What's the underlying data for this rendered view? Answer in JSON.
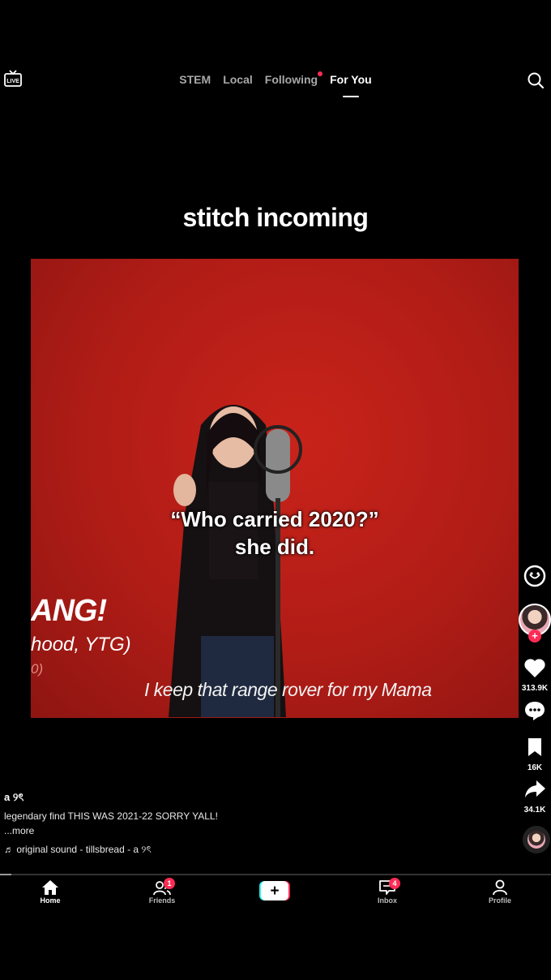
{
  "top_nav": {
    "live_label": "LIVE",
    "tabs": [
      {
        "label": "STEM",
        "active": false
      },
      {
        "label": "Local",
        "active": false
      },
      {
        "label": "Following",
        "active": false,
        "has_dot": true
      },
      {
        "label": "For You",
        "active": true
      }
    ]
  },
  "caption_top": "stitch incoming",
  "video": {
    "overlay_line1": "“Who carried 2020?”",
    "overlay_line2": "she did.",
    "side_title": "ANG!",
    "side_credit": "hood, YTG)",
    "side_year": "0)",
    "lyric": "I keep that range rover for my Mama"
  },
  "right_rail": {
    "like_count": "313.9K",
    "bookmark_count": "16K",
    "share_count": "34.1K",
    "follow_symbol": "+"
  },
  "post": {
    "username": "a ୨ৎ",
    "description": "legendary find THIS WAS 2021-22 SORRY YALL!",
    "more": "...more",
    "sound": "♬ original sound - tillsbread - a ୨ৎ"
  },
  "progress_fraction": 0.02,
  "bottom_nav": {
    "home": "Home",
    "friends": "Friends",
    "friends_badge": "1",
    "inbox": "Inbox",
    "inbox_badge": "4",
    "profile": "Profile",
    "create_symbol": "+"
  },
  "colors": {
    "accent": "#fe2c55",
    "teal": "#25f4ee",
    "video_bg": "#b01c16"
  }
}
